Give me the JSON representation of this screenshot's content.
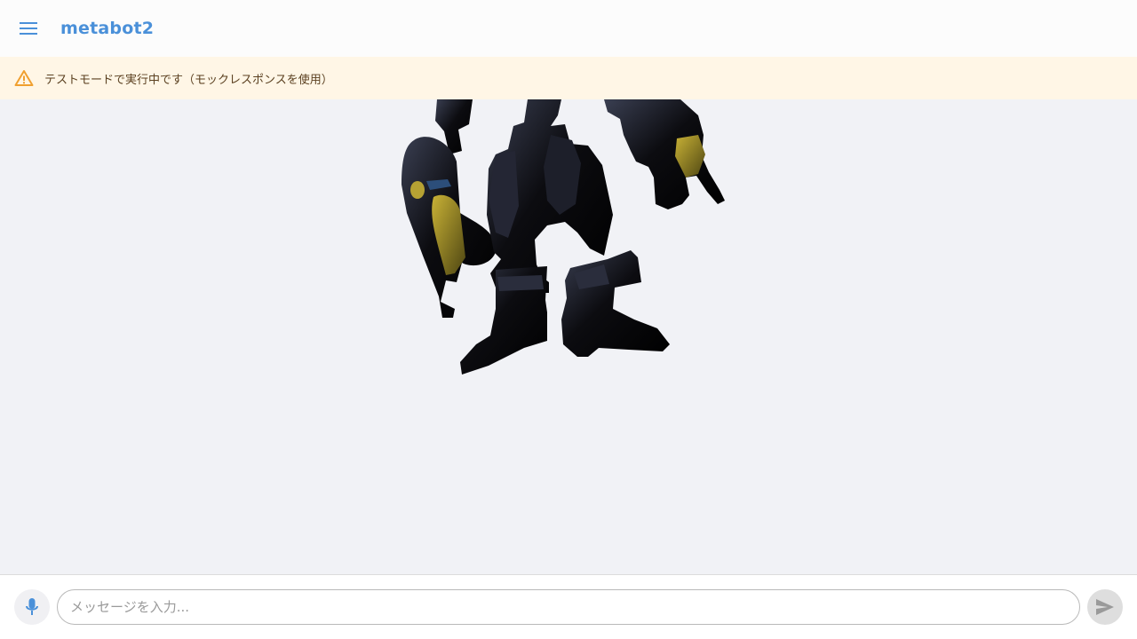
{
  "header": {
    "title": "metabot2",
    "menu_icon": "hamburger-menu-icon"
  },
  "banner": {
    "icon": "warning-icon",
    "text": "テストモードで実行中です（モックレスポンスを使用）"
  },
  "composer": {
    "mic_icon": "microphone-icon",
    "placeholder": "メッセージを入力...",
    "value": "",
    "send_icon": "send-icon"
  },
  "colors": {
    "accent": "#4a90d9",
    "banner_bg": "#fff6e6",
    "warning": "#f0a030",
    "stage_bg": "#f1f2f6"
  }
}
